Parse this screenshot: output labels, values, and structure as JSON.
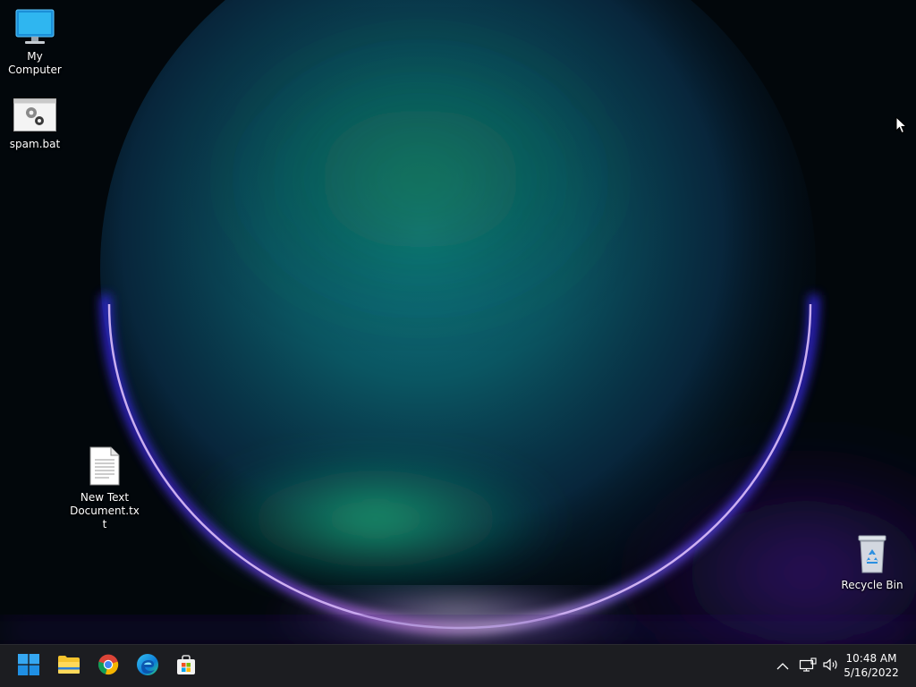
{
  "desktop_icons": {
    "my_computer": {
      "label": "My Computer",
      "icon": "monitor-icon"
    },
    "spam_bat": {
      "label": "spam.bat",
      "icon": "batch-file-icon"
    },
    "new_text_document": {
      "label": "New Text Document.txt",
      "icon": "text-file-icon"
    },
    "recycle_bin": {
      "label": "Recycle Bin",
      "icon": "recycle-bin-icon"
    }
  },
  "taskbar": {
    "apps": [
      {
        "name": "Start",
        "icon": "windows-logo-icon"
      },
      {
        "name": "File Explorer",
        "icon": "folder-icon"
      },
      {
        "name": "Google Chrome",
        "icon": "chrome-icon"
      },
      {
        "name": "Microsoft Edge",
        "icon": "edge-icon"
      },
      {
        "name": "Microsoft Store",
        "icon": "store-icon"
      }
    ],
    "tray": {
      "icons": [
        "chevron-up-icon",
        "network-icon",
        "volume-icon"
      ],
      "time": "10:48 AM",
      "date": "5/16/2022"
    }
  },
  "colors": {
    "taskbar_bg": "#1c1d21",
    "accent": "#0078d4"
  }
}
